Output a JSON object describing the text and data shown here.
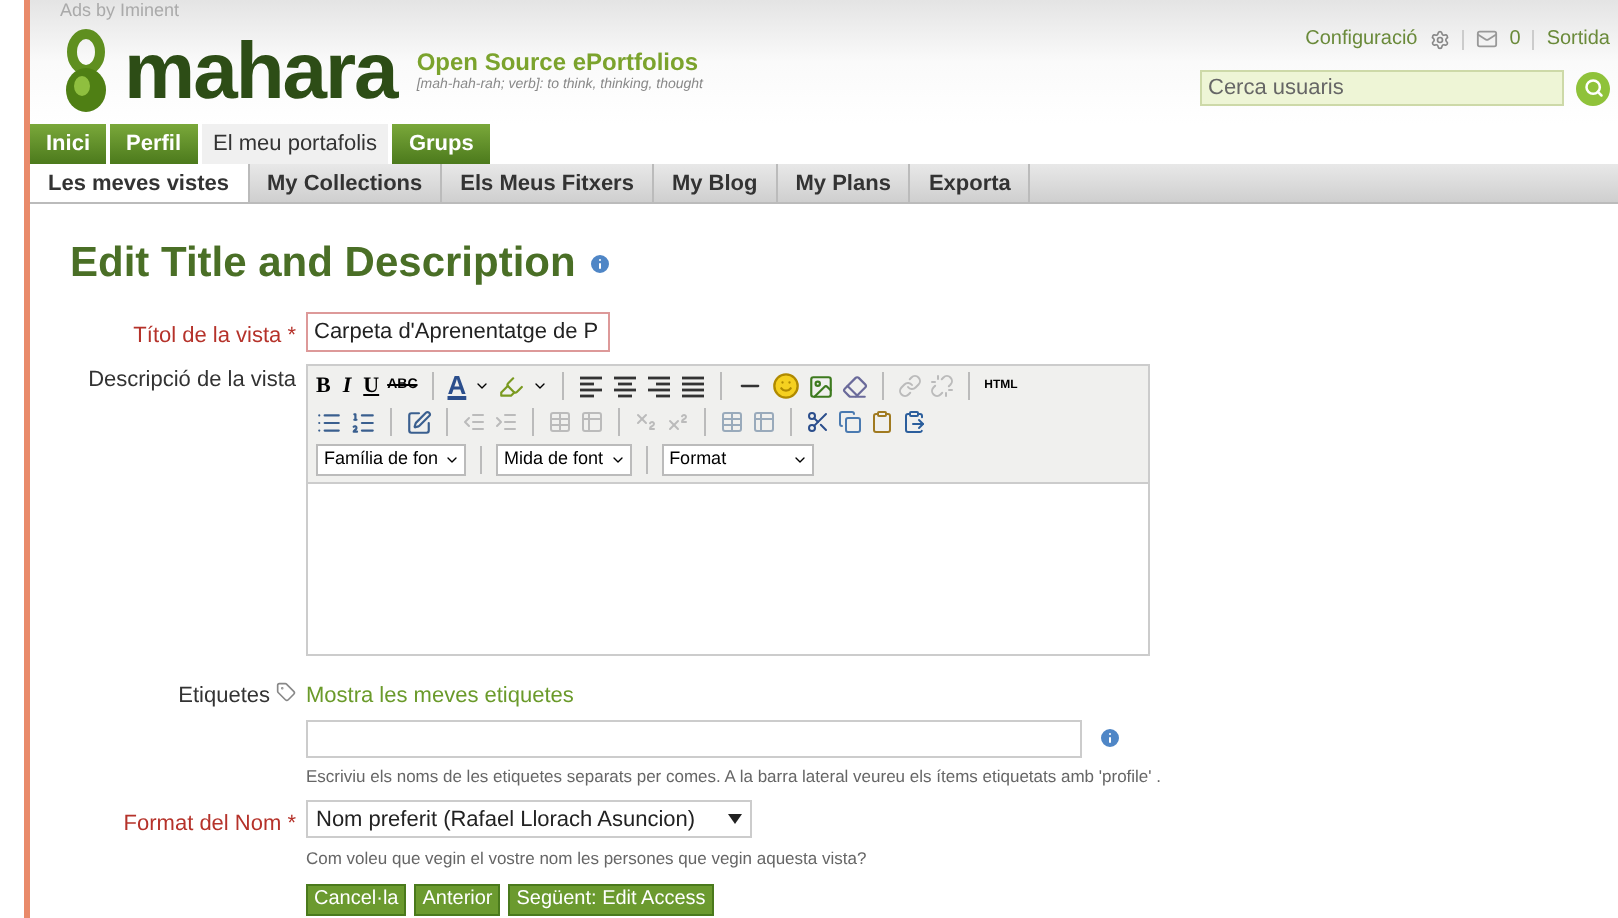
{
  "ad_text": "Ads by Iminent",
  "logo": {
    "wordmark": "mahara",
    "tagline": "Open Source ePortfolios",
    "definition": "[mah-hah-rah; verb]: to think, thinking, thought"
  },
  "top_links": {
    "settings": "Configuració",
    "messages": "0",
    "logout": "Sortida"
  },
  "search": {
    "placeholder": "Cerca usuaris"
  },
  "main_tabs": [
    {
      "label": "Inici",
      "selected": false
    },
    {
      "label": "Perfil",
      "selected": false
    },
    {
      "label": "El meu portafolis",
      "selected": true
    },
    {
      "label": "Grups",
      "selected": false
    }
  ],
  "sub_tabs": [
    {
      "label": "Les meves vistes",
      "selected": true
    },
    {
      "label": "My Collections",
      "selected": false
    },
    {
      "label": "Els Meus Fitxers",
      "selected": false
    },
    {
      "label": "My Blog",
      "selected": false
    },
    {
      "label": "My Plans",
      "selected": false
    },
    {
      "label": "Exporta",
      "selected": false
    }
  ],
  "heading": "Edit Title and Description",
  "title_field": {
    "label": "Títol de la vista",
    "required": true,
    "required_mark": "*",
    "value": "Carpeta d'Aprenentatge de P"
  },
  "description_field": {
    "label": "Descripció de la vista",
    "required": false,
    "toolbar_text": {
      "bold": "B",
      "italic": "I",
      "underline": "U",
      "strike": "ABC",
      "font_letter": "A",
      "html": "HTML"
    },
    "dropdowns": [
      {
        "label": "Família de fon"
      },
      {
        "label": "Mida de font"
      },
      {
        "label": "Format"
      }
    ]
  },
  "tags_field": {
    "label": "Etiquetes",
    "link": "Mostra les meves etiquetes",
    "help": "Escriviu els noms de les etiquetes separats per comes. A la barra lateral veureu els ítems etiquetats amb 'profile' ."
  },
  "name_format_field": {
    "label": "Format del Nom",
    "required": true,
    "required_mark": "*",
    "value": "Nom preferit (Rafael Llorach Asuncion)",
    "help": "Com voleu que vegin el vostre nom les persones que vegin aquesta vista?"
  },
  "buttons": [
    "Cancel·la",
    "Anterior",
    "Següent: Edit Access"
  ]
}
